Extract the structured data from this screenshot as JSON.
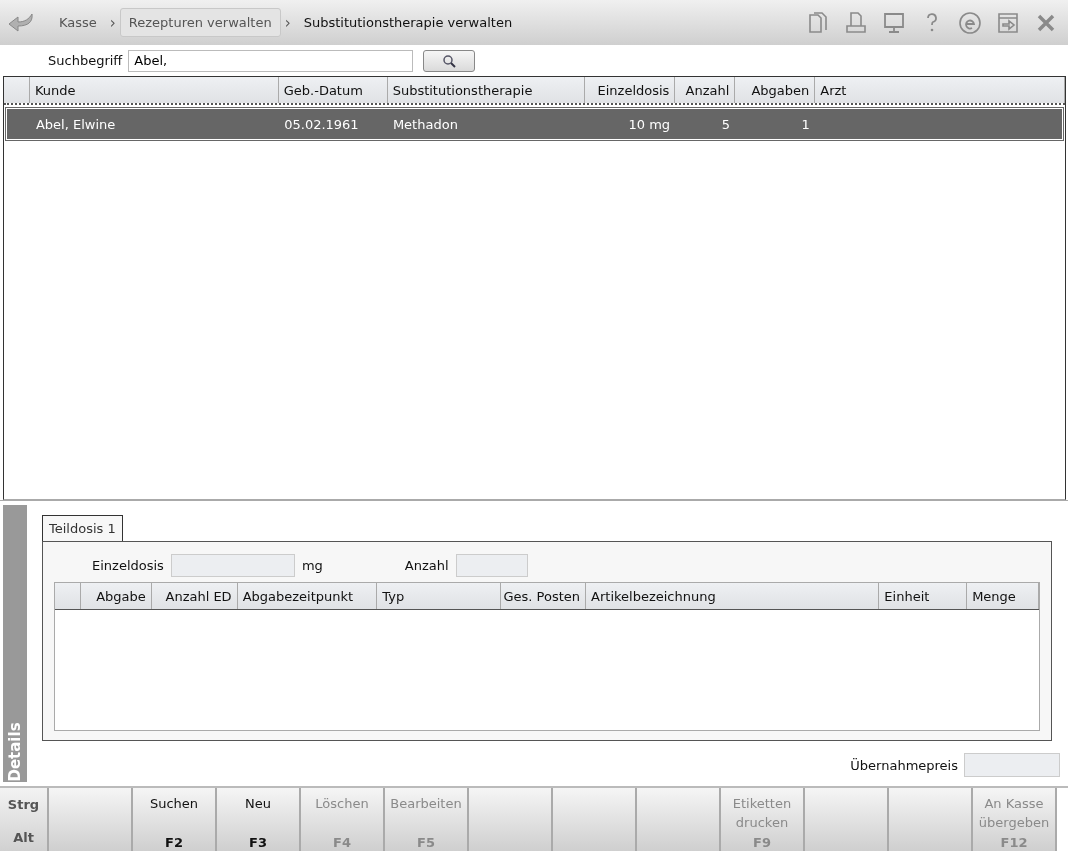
{
  "breadcrumbs": [
    {
      "label": "Kasse",
      "kind": "link"
    },
    {
      "label": "Rezepturen verwalten",
      "kind": "button"
    },
    {
      "label": "Substitutionstherapie verwalten",
      "kind": "current"
    }
  ],
  "breadcrumb_separator": "›",
  "search": {
    "label": "Suchbegriff",
    "value": "Abel,"
  },
  "table": {
    "columns": [
      "Kunde",
      "Geb.-Datum",
      "Substitutionstherapie",
      "Einzeldosis",
      "Anzahl",
      "Abgaben",
      "Arzt"
    ],
    "rows": [
      {
        "selected": true,
        "cells": [
          "Abel, Elwine",
          "05.02.1961",
          "Methadon",
          "10 mg",
          "5",
          "1",
          null
        ]
      }
    ]
  },
  "details": {
    "side_label": "Details",
    "tabs": [
      {
        "label": "Teildosis 1",
        "selected": true
      }
    ],
    "einzeldosis_label": "Einzeldosis",
    "einzeldosis_unit": "mg",
    "anzahl_label": "Anzahl",
    "columns": [
      "Abgabe",
      "Anzahl ED",
      "Abgabezeitpunkt",
      "Typ",
      "Ges. Posten",
      "Artikelbezeichnung",
      "Einheit",
      "Menge"
    ],
    "price_label": "Übernahmepreis"
  },
  "modifiers": [
    "Strg",
    "Alt"
  ],
  "function_keys": [
    {
      "kind": "blank"
    },
    {
      "kind": "action",
      "label": "Suchen",
      "key": "F2",
      "disabled": false
    },
    {
      "kind": "action",
      "label": "Neu",
      "key": "F3",
      "disabled": false
    },
    {
      "kind": "action",
      "label": "Löschen",
      "key": "F4",
      "disabled": true
    },
    {
      "kind": "action",
      "label": "Bearbeiten",
      "key": "F5",
      "disabled": true
    },
    {
      "kind": "blank"
    },
    {
      "kind": "blank"
    },
    {
      "kind": "blank"
    },
    {
      "kind": "action",
      "label": "Etiketten drucken",
      "key": "F9",
      "disabled": true
    },
    {
      "kind": "blank"
    },
    {
      "kind": "blank"
    },
    {
      "kind": "action",
      "label": "An Kasse übergeben",
      "key": "F12",
      "disabled": true
    }
  ]
}
